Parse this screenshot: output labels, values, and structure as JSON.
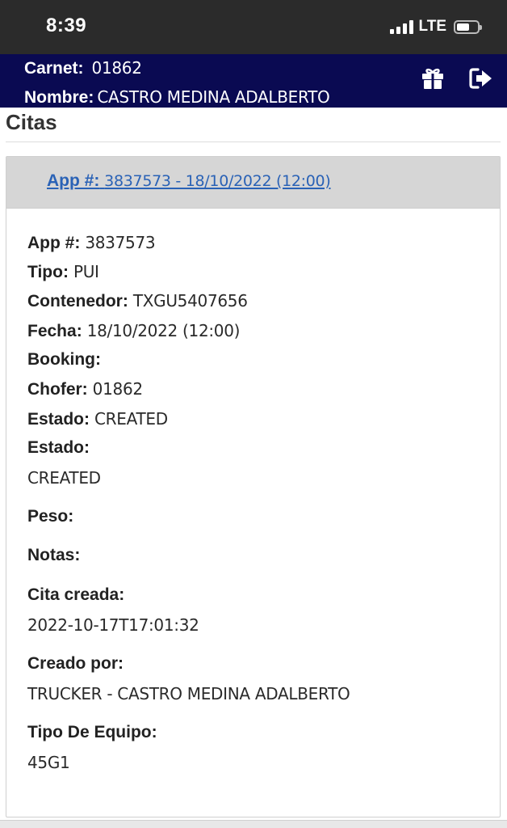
{
  "status_bar": {
    "time": "8:39",
    "network": "LTE"
  },
  "header": {
    "carnet_label": "Carnet:",
    "carnet_value": "01862",
    "nombre_label": "Nombre:",
    "nombre_value": "CASTRO MEDINA ADALBERTO",
    "background": "#0a0a52"
  },
  "page": {
    "title": "Citas"
  },
  "appointment": {
    "link_label": "App #:",
    "link_value": "3837573 - 18/10/2022 (12:00)",
    "link_color": "#2a62b6",
    "fields": {
      "app_label": "App #:",
      "app_value": "3837573",
      "tipo_label": "Tipo:",
      "tipo_value": "PUI",
      "contenedor_label": "Contenedor:",
      "contenedor_value": "TXGU5407656",
      "fecha_label": "Fecha:",
      "fecha_value": "18/10/2022 (12:00)",
      "booking_label": "Booking:",
      "chofer_label": "Chofer:",
      "chofer_value": "01862",
      "estado_label": "Estado:",
      "estado_value": "CREATED",
      "estado2_label": "Estado:",
      "estado2_value": "CREATED",
      "peso_label": "Peso:",
      "notas_label": "Notas:",
      "cita_creada_label": "Cita creada:",
      "cita_creada_value": "2022-10-17T17:01:32",
      "creado_por_label": "Creado por:",
      "creado_por_value": "TRUCKER - CASTRO MEDINA ADALBERTO",
      "tipo_equipo_label": "Tipo De Equipo:",
      "tipo_equipo_value": "45G1"
    }
  },
  "icons": {
    "header_left": "gift-icon",
    "header_right": "logout-icon"
  }
}
